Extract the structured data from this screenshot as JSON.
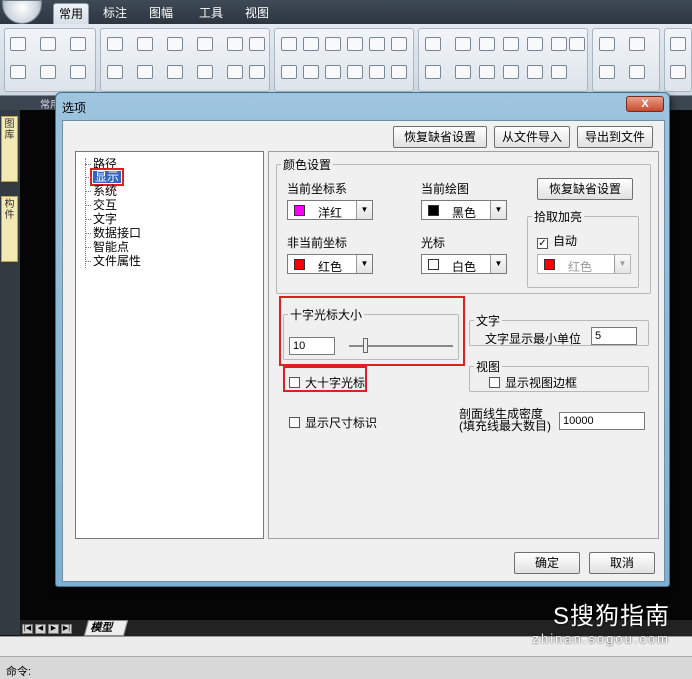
{
  "app": {
    "tabs": [
      "常用",
      "标注",
      "图幅",
      "工具",
      "视图"
    ],
    "active_tab_index": 0,
    "ribbon_group_label": "常用",
    "side_tabs": [
      "图库",
      "构件"
    ],
    "model_tab": "模型",
    "command_label": "命令:"
  },
  "watermark": {
    "brand": "S搜狗指南",
    "url": "zhinan.sogou.com"
  },
  "dialog": {
    "title": "选项",
    "close_label": "X",
    "top_buttons": [
      "恢复缺省设置",
      "从文件导入",
      "导出到文件"
    ],
    "tree": [
      "路径",
      "显示",
      "系统",
      "交互",
      "文字",
      "数据接口",
      "智能点",
      "文件属性"
    ],
    "selected_tree_index": 1,
    "color_group": {
      "title": "颜色设置",
      "current_coord_label": "当前坐标系",
      "current_coord_value": "洋红",
      "current_coord_color": "#ff00ff",
      "current_draw_label": "当前绘图",
      "current_draw_value": "黑色",
      "current_draw_color": "#000000",
      "restore_button": "恢复缺省设置",
      "non_current_coord_label": "非当前坐标",
      "non_current_coord_value": "红色",
      "non_current_coord_color": "#ff0000",
      "cursor_label": "光标",
      "cursor_value": "白色",
      "cursor_color": "#ffffff",
      "pick_group_title": "拾取加亮",
      "auto_label": "自动",
      "auto_checked": true,
      "pick_value": "红色",
      "pick_color": "#ff0000"
    },
    "cursor_size": {
      "title": "十字光标大小",
      "value": "10",
      "slider_fraction": 0.15
    },
    "text_group": {
      "title": "文字",
      "min_unit_label": "文字显示最小单位",
      "min_unit_value": "5"
    },
    "view_group": {
      "title": "视图",
      "border_label": "显示视图边框",
      "border_checked": false
    },
    "big_cross_label": "大十字光标",
    "big_cross_checked": false,
    "dim_mark_label": "显示尺寸标识",
    "dim_mark_checked": false,
    "hatch_label": "剖面线生成密度",
    "hatch_sub": "(填充线最大数目)",
    "hatch_value": "10000",
    "ok_label": "确定",
    "cancel_label": "取消",
    "highlight_color": "#e02020"
  }
}
